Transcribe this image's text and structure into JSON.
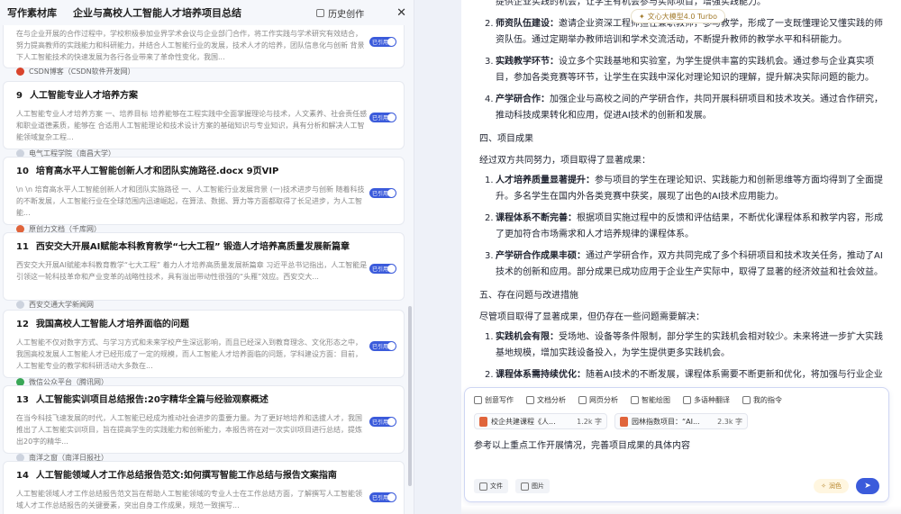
{
  "header": {
    "app_title": "写作素材库",
    "doc_title": "企业与高校人工智能人才培养项目总结",
    "history_label": "历史创作",
    "close_symbol": "✕"
  },
  "cards": [
    {
      "number": "",
      "title": "",
      "excerpt": "在与企业开展的合作过程中，学校积极参加业界学术会议与企业部门合作，将工作实践与学术研究有效结合，努力提高教师的实践能力和科研能力，并结合人工智能行业的发展，技术人才的培养，团队信息化与创新 背景下人工智能技术的快速发展为各行各业带来了革命性变化，我国...",
      "source": "CSDN博客（CSDN软件开发网）"
    },
    {
      "number": "9",
      "title": "人工智能专业人才培养方案",
      "excerpt": "人工智能专业人才培养方案 一、培养目标 培养能够在工程实践中全面掌握理论与技术，人文素养、社会责任感和职业道德素质，能够在 合适用人工智能理论和技术设计方案的基础知识与专业知识，具有分析和解决人工智能领域复杂工程...",
      "source": "电气工程学院（南昌大学）"
    },
    {
      "number": "10",
      "title": "培育高水平人工智能创新人才和团队实施路径.docx 9页VIP",
      "excerpt": "\\n \\n 培育高水平人工智能创新人才和团队实施路径 一、人工智能行业发展背景 (一)技术进步与创新 随着科技的不断发展，人工智能行业在全球范围内迅速崛起，在算法、数据、算力等方面都取得了长足进步，为人工智能...",
      "source": "原创力文档（千库网）"
    },
    {
      "number": "11",
      "title": "西安交大开展AI赋能本科教育教学“七大工程” 锻造人才培养高质量发展新篇章",
      "excerpt": "西安交大开展AI赋能本科教育教学“七大工程” 着力人才培养高质量发展新篇章 习近平总书记指出，人工智能是引领这一轮科技革命和产业变革的战略性技术，具有溢出带动性很强的“头雁”效应。西安交大...",
      "source": "西安交通大学新闻网"
    },
    {
      "number": "12",
      "title": "我国高校人工智能人才培养面临的问题",
      "excerpt": "人工智能不仅对数字方式、与学习方式和未来学校产生深远影响，而且已经深入到教育理念、文化形态之中，我国高校发展人工智能人才已经形成了一定的规模，而人工智能人才培养面临的问题，学科建设方面：目前，人工智能专业的教学和科研活动大多数在...",
      "source": "微信公众平台（腾讯网）"
    },
    {
      "number": "13",
      "title": "人工智能实训项目总结报告:20字精华全篇与经验观察概述",
      "excerpt": "在当今科技飞速发展的时代，人工智能已经成为推动社会进步的重要力量。为了更好地培养和选拔人才，我国推出了人工智能实训项目，旨在提高学生的实践能力和创新能力，本报告将在对一次实训项目进行总结，提炼出20字的精华...",
      "source": "南洋之窗（南洋日报社）"
    },
    {
      "number": "14",
      "title": "人工智能领域人才工作总结报告范文:如何撰写智能工作总结与报告文案指南",
      "excerpt": "人工智能领域人才工作总结报告范文旨在帮助人工智能领域的专业人士在工作总结方面，了解撰写人工智能领域人才工作总结报告的关键要素，突出自身工作成果，规范一致撰写...",
      "source": ""
    }
  ],
  "document": {
    "items_top": [
      {
        "number": "",
        "bold": "",
        "text": "提供企业实践的机会，让学生有机会参与实际项目，增强实践能力。"
      },
      {
        "number": "2.",
        "bold": "师资队伍建设：",
        "text": "邀请企业资深工程师担任兼职教师，参与教学，形成了一支既懂理论又懂实践的师资队伍。通过定期举办教师培训和学术交流活动，不断提升教师的教学水平和科研能力。"
      },
      {
        "number": "3.",
        "bold": "实践教学环节：",
        "text": "设立多个实践基地和实验室，为学生提供丰富的实践机会。通过参与企业真实项目，参加各类竞赛等环节，让学生在实践中深化对理论知识的理解，提升解决实际问题的能力。"
      },
      {
        "number": "4.",
        "bold": "产学研合作：",
        "text": "加强企业与高校之间的产学研合作，共同开展科研项目和技术攻关。通过合作研究，推动科技成果转化和应用，促进AI技术的创新和发展。"
      }
    ],
    "section4_title": "四、项目成果",
    "section4_intro": "经过双方共同努力，项目取得了显著成果：",
    "section4_items": [
      {
        "number": "1.",
        "bold": "人才培养质量显著提升：",
        "text": "参与项目的学生在理论知识、实践能力和创新思维等方面均得到了全面提升。多名学生在国内外各类竞赛中获奖，展现了出色的AI技术应用能力。"
      },
      {
        "number": "2.",
        "bold": "课程体系不断完善：",
        "text": "根据项目实施过程中的反馈和评估结果，不断优化课程体系和教学内容，形成了更加符合市场需求和人才培养规律的课程体系。"
      },
      {
        "number": "3.",
        "bold": "产学研合作成果丰硕：",
        "text": "通过产学研合作，双方共同完成了多个科研项目和技术攻关任务，推动了AI技术的创新和应用。部分成果已成功应用于企业生产实际中，取得了显著的经济效益和社会效益。"
      }
    ],
    "section5_title": "五、存在问题与改进措施",
    "section5_intro": "尽管项目取得了显著成果，但仍存在一些问题需要解决：",
    "section5_items": [
      {
        "number": "1.",
        "bold": "实践机会有限：",
        "text": "受场地、设备等条件限制，部分学生的实践机会相对较少。未来将进一步扩大实践基地规模，增加实践设备投入，为学生提供更多实践机会。"
      },
      {
        "number": "2.",
        "bold": "课程体系需持续优化：",
        "text": "随着AI技术的不断发展，课程体系需要不断更新和优化，将加强与行业企业的沟通合作，及时调整课程内容。"
      }
    ]
  },
  "model_chip": "文心大模型4.0 Turbo",
  "composer": {
    "toolbar": [
      "创意写作",
      "文档分析",
      "网页分析",
      "智能绘图",
      "多语种翻译",
      "我的指令"
    ],
    "attachments": [
      {
        "name": "校企共建课程《人...",
        "size": "1.2k 字"
      },
      {
        "name": "园林指数项目：“AI...",
        "size": "2.3k 字"
      }
    ],
    "prompt": "参考以上重点工作开展情况，完善项目成果的具体内容",
    "file_label": "文件",
    "image_label": "图片",
    "polish_label": "润色"
  }
}
